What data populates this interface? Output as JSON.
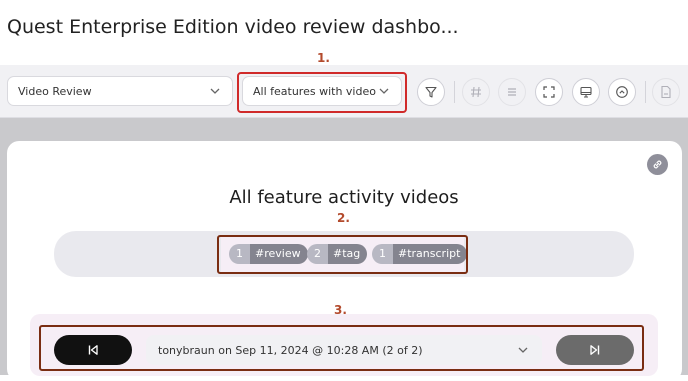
{
  "page": {
    "title": "Quest Enterprise Edition video review dashbo..."
  },
  "annotations": {
    "one": "1.",
    "two": "2.",
    "three": "3."
  },
  "toolbar": {
    "dashboard_select": "Video Review",
    "filter_select": "All features with video",
    "icons": [
      "filter-icon",
      "hashtag-icon",
      "list-icon",
      "fullscreen-icon",
      "presentation-icon",
      "collapse-up-icon",
      "export-pdf-icon"
    ]
  },
  "card": {
    "title": "All feature activity videos",
    "tags": [
      {
        "count": "1",
        "name": "#review"
      },
      {
        "count": "2",
        "name": "#tag"
      },
      {
        "count": "1",
        "name": "#transcript"
      }
    ],
    "session_select": "tonybraun on Sep 11, 2024 @ 10:28 AM (2 of 2)"
  },
  "colors": {
    "annotation_red": "#d02a2a",
    "annotation_brown": "#7a2d12",
    "annotation_number": "#b34a2c",
    "prev_button": "#111111",
    "next_button": "#6b6b6b",
    "highlight_pink": "#f6eef6"
  }
}
